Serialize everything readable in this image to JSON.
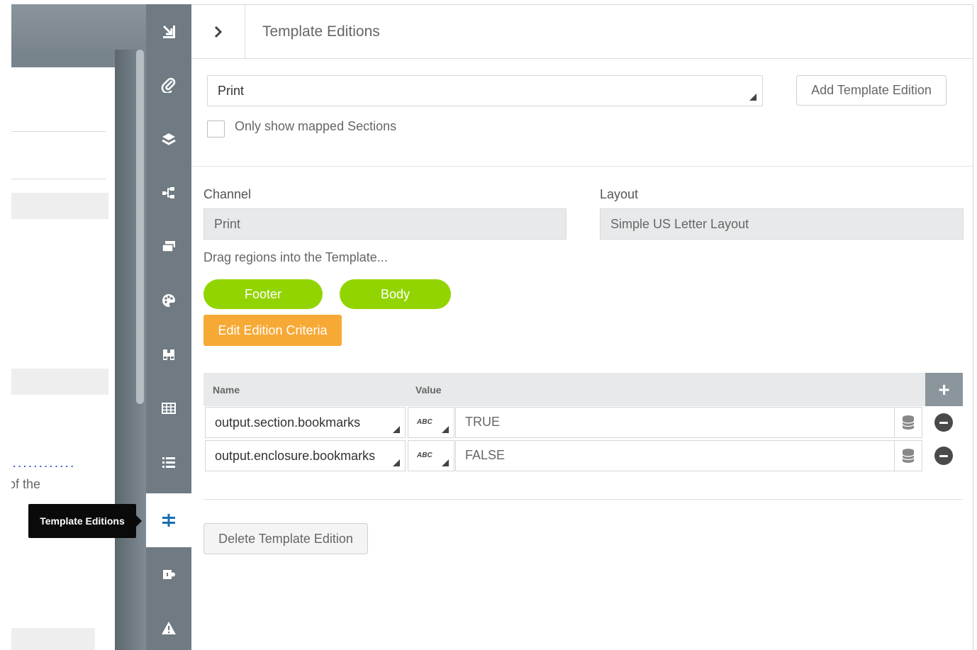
{
  "tooltip": {
    "text": "Template Editions"
  },
  "canvas": {
    "text_fragment": "of the",
    "dots": "............"
  },
  "rail": {
    "items": [
      {
        "icon": "collapse-to-corner-icon"
      },
      {
        "icon": "paperclip-icon"
      },
      {
        "icon": "layers-icon"
      },
      {
        "icon": "hierarchy-icon"
      },
      {
        "icon": "cards-icon"
      },
      {
        "icon": "palette-icon"
      },
      {
        "icon": "binoculars-icon"
      },
      {
        "icon": "table-grid-icon"
      },
      {
        "icon": "list-icon"
      },
      {
        "icon": "template-editions-icon",
        "active": true
      },
      {
        "icon": "puzzle-icon"
      },
      {
        "icon": "warning-icon"
      }
    ]
  },
  "panel": {
    "title": "Template Editions",
    "edition_select": {
      "value": "Print"
    },
    "add_edition_label": "Add Template Edition",
    "only_mapped_label": "Only show mapped Sections",
    "only_mapped_checked": false,
    "channel": {
      "label": "Channel",
      "value": "Print"
    },
    "layout": {
      "label": "Layout",
      "value": "Simple US Letter Layout"
    },
    "drag_hint": "Drag regions into the Template...",
    "regions": [
      "Footer",
      "Body"
    ],
    "criteria_button": "Edit Edition Criteria",
    "table": {
      "headers": {
        "name": "Name",
        "value": "Value"
      },
      "add_label": "+",
      "rows": [
        {
          "name": "output.section.bookmarks",
          "type": "ABC",
          "value": "TRUE"
        },
        {
          "name": "output.enclosure.bookmarks",
          "type": "ABC",
          "value": "FALSE"
        }
      ]
    },
    "delete_edition_label": "Delete Template Edition"
  },
  "colors": {
    "region_green": "#92d400",
    "criteria_orange": "#f7a935",
    "rail_bg": "#6f7a82",
    "active_icon": "#1a6fb2"
  }
}
